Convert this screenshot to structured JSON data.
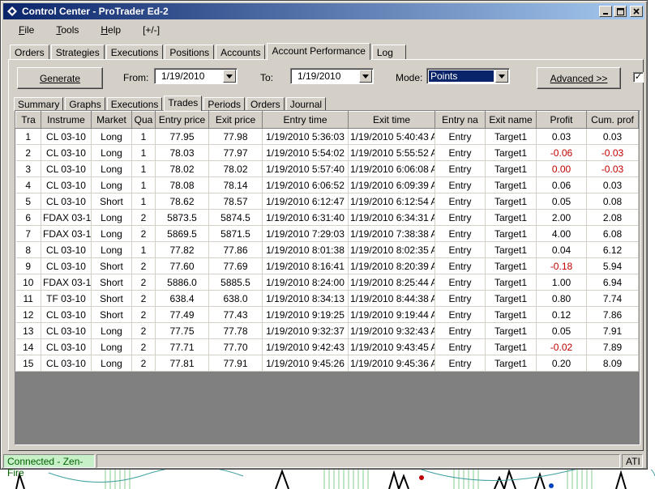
{
  "window": {
    "title": "Control Center - ProTrader Ed-2"
  },
  "menu": [
    {
      "key": "F",
      "rest": "ile"
    },
    {
      "key": "T",
      "rest": "ools"
    },
    {
      "key": "H",
      "rest": "elp"
    },
    {
      "key": "",
      "rest": "[+/-]"
    }
  ],
  "outer_tabs": [
    "Orders",
    "Strategies",
    "Executions",
    "Positions",
    "Accounts",
    "Account Performance",
    "Log"
  ],
  "toolbar": {
    "generate_label": "Generate",
    "from_label": "From:",
    "from_value": "1/19/2010",
    "to_label": "To:",
    "to_value": "1/19/2010",
    "mode_label": "Mode:",
    "mode_value": "Points",
    "advanced_label": "Advanced >>",
    "checkbox_mark": "✓"
  },
  "inner_tabs": [
    "Summary",
    "Graphs",
    "Executions",
    "Trades",
    "Periods",
    "Orders",
    "Journal"
  ],
  "table": {
    "columns": [
      "Tra",
      "Instrume",
      "Market",
      "Qua",
      "Entry price",
      "Exit price",
      "Entry time",
      "Exit time",
      "Entry na",
      "Exit name",
      "Profit",
      "Cum. prof"
    ],
    "rows": [
      [
        "1",
        "CL 03-10",
        "Long",
        "1",
        "77.95",
        "77.98",
        "1/19/2010 5:36:03",
        "1/19/2010 5:40:43 A",
        "Entry",
        "Target1",
        "0.03",
        "0.03"
      ],
      [
        "2",
        "CL 03-10",
        "Long",
        "1",
        "78.03",
        "77.97",
        "1/19/2010 5:54:02",
        "1/19/2010 5:55:52 A",
        "Entry",
        "Target1",
        "-0.06",
        "-0.03"
      ],
      [
        "3",
        "CL 03-10",
        "Long",
        "1",
        "78.02",
        "78.02",
        "1/19/2010 5:57:40",
        "1/19/2010 6:06:08 A",
        "Entry",
        "Target1",
        "0.00",
        "-0.03"
      ],
      [
        "4",
        "CL 03-10",
        "Long",
        "1",
        "78.08",
        "78.14",
        "1/19/2010 6:06:52",
        "1/19/2010 6:09:39 A",
        "Entry",
        "Target1",
        "0.06",
        "0.03"
      ],
      [
        "5",
        "CL 03-10",
        "Short",
        "1",
        "78.62",
        "78.57",
        "1/19/2010 6:12:47",
        "1/19/2010 6:12:54 A",
        "Entry",
        "Target1",
        "0.05",
        "0.08"
      ],
      [
        "6",
        "FDAX 03-1",
        "Long",
        "2",
        "5873.5",
        "5874.5",
        "1/19/2010 6:31:40",
        "1/19/2010 6:34:31 A",
        "Entry",
        "Target1",
        "2.00",
        "2.08"
      ],
      [
        "7",
        "FDAX 03-1",
        "Long",
        "2",
        "5869.5",
        "5871.5",
        "1/19/2010 7:29:03",
        "1/19/2010 7:38:38 A",
        "Entry",
        "Target1",
        "4.00",
        "6.08"
      ],
      [
        "8",
        "CL 03-10",
        "Long",
        "1",
        "77.82",
        "77.86",
        "1/19/2010 8:01:38",
        "1/19/2010 8:02:35 A",
        "Entry",
        "Target1",
        "0.04",
        "6.12"
      ],
      [
        "9",
        "CL 03-10",
        "Short",
        "2",
        "77.60",
        "77.69",
        "1/19/2010 8:16:41",
        "1/19/2010 8:20:39 A",
        "Entry",
        "Target1",
        "-0.18",
        "5.94"
      ],
      [
        "10",
        "FDAX 03-1",
        "Short",
        "2",
        "5886.0",
        "5885.5",
        "1/19/2010 8:24:00",
        "1/19/2010 8:25:44 A",
        "Entry",
        "Target1",
        "1.00",
        "6.94"
      ],
      [
        "11",
        "TF 03-10",
        "Short",
        "2",
        "638.4",
        "638.0",
        "1/19/2010 8:34:13",
        "1/19/2010 8:44:38 A",
        "Entry",
        "Target1",
        "0.80",
        "7.74"
      ],
      [
        "12",
        "CL 03-10",
        "Short",
        "2",
        "77.49",
        "77.43",
        "1/19/2010 9:19:25",
        "1/19/2010 9:19:44 A",
        "Entry",
        "Target1",
        "0.12",
        "7.86"
      ],
      [
        "13",
        "CL 03-10",
        "Long",
        "2",
        "77.75",
        "77.78",
        "1/19/2010 9:32:37",
        "1/19/2010 9:32:43 A",
        "Entry",
        "Target1",
        "0.05",
        "7.91"
      ],
      [
        "14",
        "CL 03-10",
        "Long",
        "2",
        "77.71",
        "77.70",
        "1/19/2010 9:42:43",
        "1/19/2010 9:43:45 A",
        "Entry",
        "Target1",
        "-0.02",
        "7.89"
      ],
      [
        "15",
        "CL 03-10",
        "Long",
        "2",
        "77.81",
        "77.91",
        "1/19/2010 9:45:26",
        "1/19/2010 9:45:36 A",
        "Entry",
        "Target1",
        "0.20",
        "8.09"
      ]
    ]
  },
  "status": {
    "connection": "Connected - Zen-Fire",
    "ati": "ATI"
  },
  "colors": {
    "negative": "#c00000",
    "connected_bg": "#c8f0c8",
    "title_start": "#0a246a",
    "title_end": "#a6caf0"
  }
}
